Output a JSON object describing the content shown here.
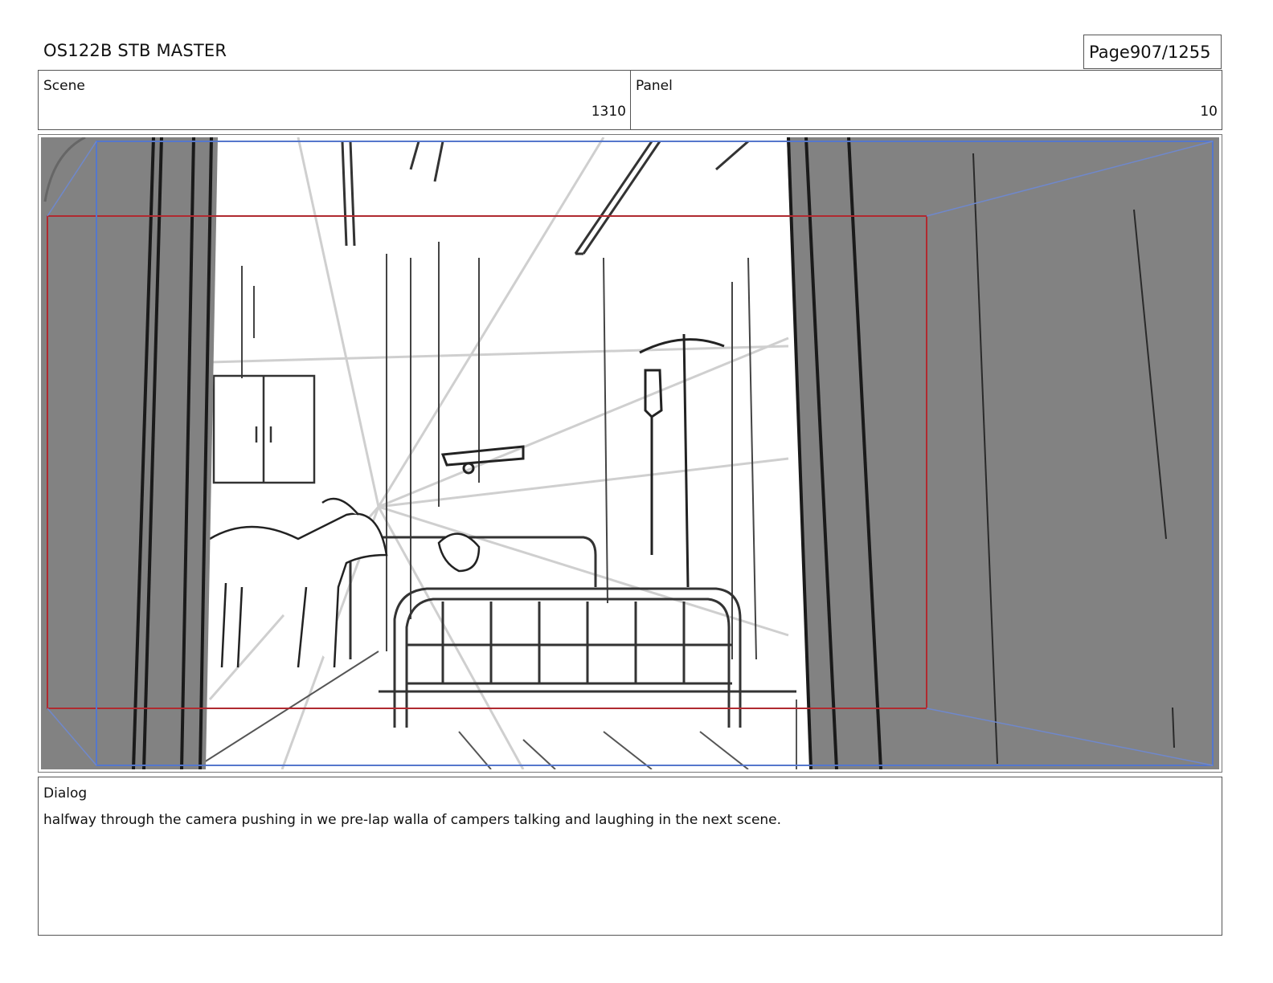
{
  "header": {
    "title": "OS122B STB MASTER",
    "page_label": "Page",
    "page_number": "907/1255"
  },
  "info": {
    "scene_label": "Scene",
    "scene_value": "1310",
    "panel_label": "Panel",
    "panel_value": "10"
  },
  "frame": {
    "colors": {
      "door_gray": "#828282",
      "camera_start_frame": "#b02a30",
      "camera_end_frame": "#5577cc",
      "sketch_line": "#2a2a2a"
    }
  },
  "dialog": {
    "label": "Dialog",
    "text": "halfway through the camera pushing in we pre-lap walla of campers talking and laughing in the next scene."
  }
}
